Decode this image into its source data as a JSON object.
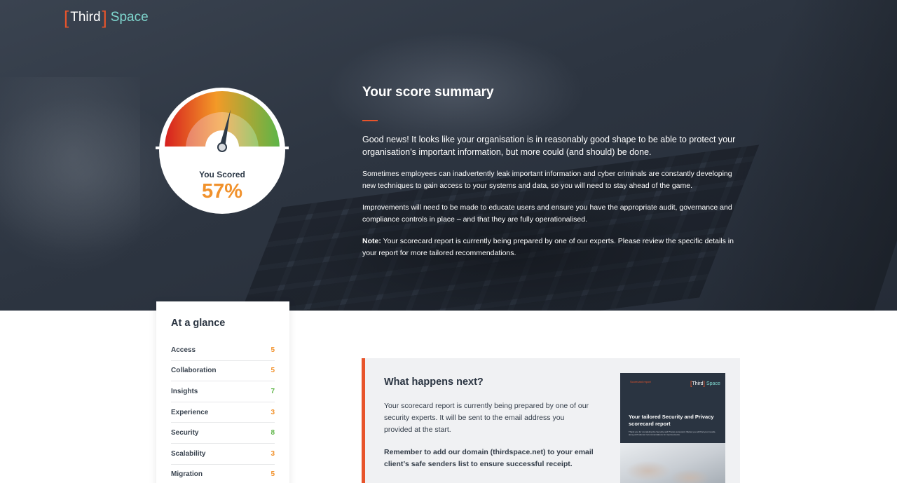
{
  "brand": {
    "bracket_left": "[",
    "name_first": "Third",
    "bracket_right": "]",
    "name_second": "Space"
  },
  "gauge": {
    "label": "You Scored",
    "value": "57%",
    "percent": 57
  },
  "summary": {
    "title": "Your score summary",
    "lead": "Good news! It looks like your organisation is in reasonably good shape to be able to protect your organisation’s important information, but more could (and should) be done.",
    "para1": "Sometimes employees can inadvertently leak important information and cyber criminals are constantly developing new techniques to gain access to your systems and data, so you will need to stay ahead of the game.",
    "para2": "Improvements will need to be made to educate users and ensure you have the appropriate audit, governance and compliance controls in place – and that they are fully operationalised.",
    "note_label": "Note:",
    "note_text": " Your scorecard report is currently being prepared by one of our experts. Please review the specific details in your report for more tailored recommendations."
  },
  "glance": {
    "title": "At a glance",
    "items": [
      {
        "label": "Access",
        "score": "5",
        "color": "#f1922d"
      },
      {
        "label": "Collaboration",
        "score": "5",
        "color": "#f1922d"
      },
      {
        "label": "Insights",
        "score": "7",
        "color": "#5fb548"
      },
      {
        "label": "Experience",
        "score": "3",
        "color": "#f1922d"
      },
      {
        "label": "Security",
        "score": "8",
        "color": "#5fb548"
      },
      {
        "label": "Scalability",
        "score": "3",
        "color": "#f1922d"
      },
      {
        "label": "Migration",
        "score": "5",
        "color": "#f1922d"
      }
    ]
  },
  "next": {
    "title": "What happens next?",
    "body": "Your scorecard report is currently being prepared by one of our security experts. It will be sent to the email address you provided at the start.",
    "strong": "Remember to add our domain (thirdspace.net) to your email client’s safe senders list to ensure successful receipt."
  },
  "report_cover": {
    "tag": "Scorecard report",
    "title": "Your tailored Security and Privacy scorecard report",
    "small": "Thank you for completing the Security and Privacy scorecard. Below you will find your results, along with tailored recommendations for improvements."
  },
  "colors": {
    "accent": "#e8542b",
    "score_orange": "#f1922d",
    "score_green": "#5fb548",
    "teal": "#7fd7cf"
  }
}
